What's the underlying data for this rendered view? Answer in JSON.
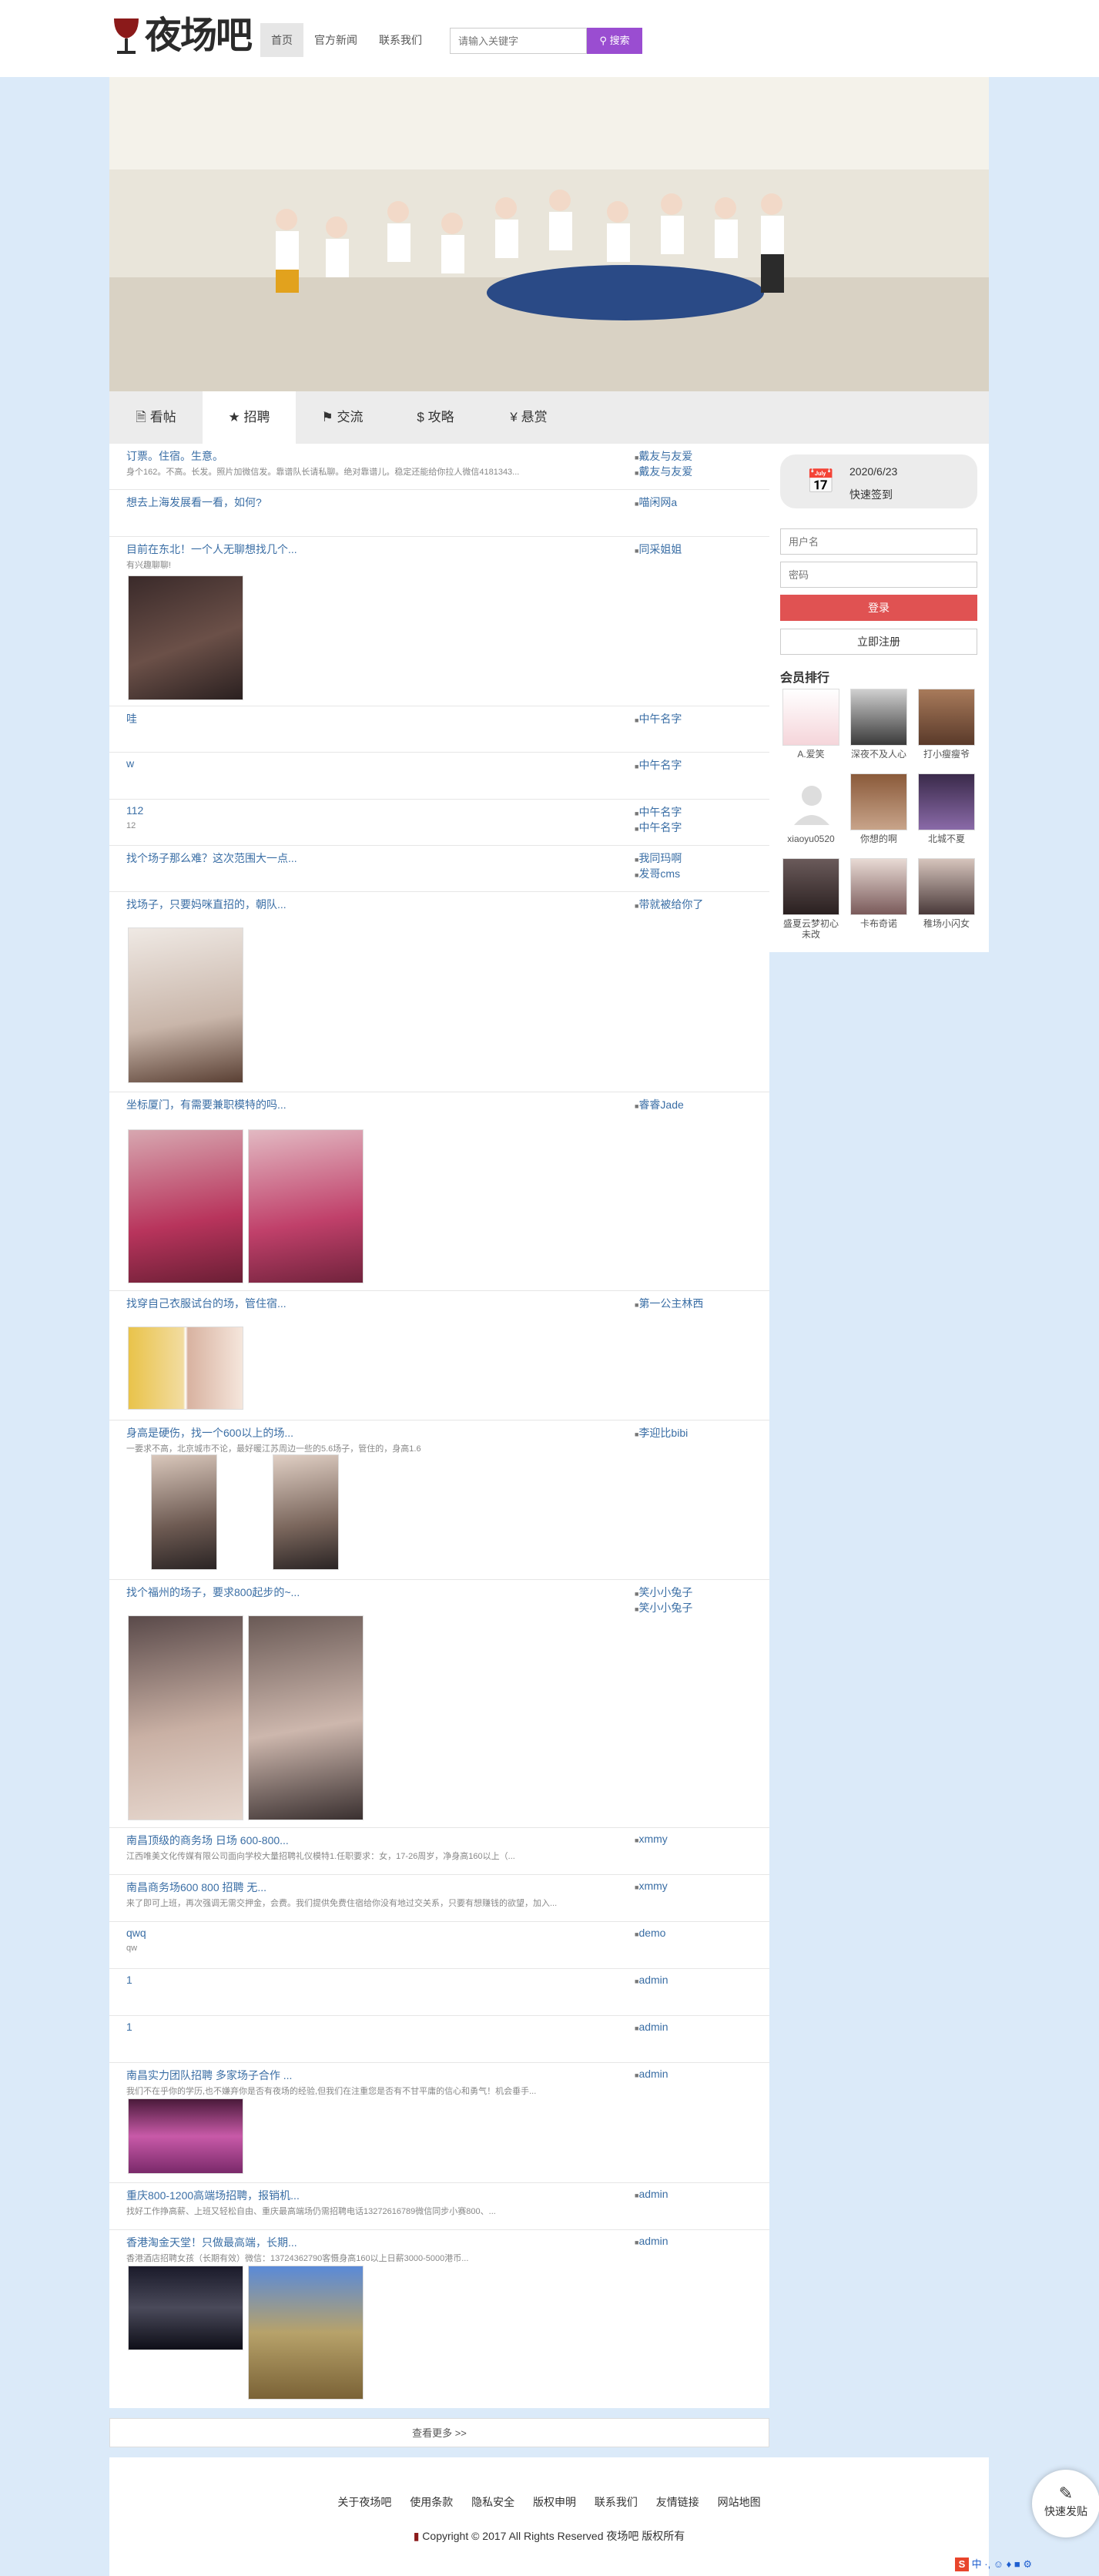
{
  "header": {
    "logo_text": "夜场吧",
    "nav": [
      "首页",
      "官方新闻",
      "联系我们"
    ],
    "search_placeholder": "请输入关键字",
    "search_btn": "搜索"
  },
  "tabs": [
    "看帖",
    "招聘",
    "交流",
    "攻略",
    "悬赏"
  ],
  "posts": [
    {
      "title": "订票。住宿。生意。",
      "summary": "身个162。不高。长发。照片加微信发。靠谱队长请私聊。绝对靠谱儿。稳定还能给你拉人微信4181343...",
      "author": "戴友与友爱",
      "reply": "戴友与友爱"
    },
    {
      "title": "想去上海发展看一看，如何?",
      "summary": "",
      "author": "喵闲网a",
      "reply": ""
    },
    {
      "title": "目前在东北！一个人无聊想找几个...",
      "summary": "有兴趣聊聊!",
      "author": "同采姐姐",
      "reply": ""
    },
    {
      "title": "哇",
      "summary": "",
      "author": "中午名字",
      "reply": ""
    },
    {
      "title": "w",
      "summary": "",
      "author": "中午名字",
      "reply": ""
    },
    {
      "title": "112",
      "summary": "12",
      "author": "中午名字",
      "reply": "中午名字"
    },
    {
      "title": "找个场子那么难？这次范围大一点...",
      "summary": "",
      "author": "我同玛啊",
      "reply": "发哥cms"
    },
    {
      "title": "找场子，只要妈咪直招的，朝队...",
      "summary": "",
      "author": "带就被给你了",
      "reply": ""
    },
    {
      "title": "坐标厦门，有需要兼职模特的吗...",
      "summary": "",
      "author": "睿睿Jade",
      "reply": ""
    },
    {
      "title": "找穿自己衣服试台的场，管住宿...",
      "summary": "",
      "author": "第一公主林西",
      "reply": ""
    },
    {
      "title": "身高是硬伤，找一个600以上的场...",
      "summary": "一要求不高，北京城市不论，最好暖江苏周边一些的5.6场子，管住的，身高1.6",
      "author": "李迎比bibi",
      "reply": ""
    },
    {
      "title": "找个福州的场子，要求800起步的~...",
      "summary": "",
      "author": "笑小小兔子",
      "reply": "笑小小兔子"
    },
    {
      "title": "南昌顶级的商务场 日场 600-800...",
      "summary": "江西唯美文化传媒有限公司面向学校大量招聘礼仪模特1.任职要求：女，17-26周岁，净身高160以上（...",
      "author": "xmmy",
      "reply": ""
    },
    {
      "title": "南昌商务场600 800 招聘 无...",
      "summary": "来了即可上班，再次强调无需交押金，会费。我们提供免费住宿给你没有地过交关系，只要有想赚钱的欲望，加入...",
      "author": "xmmy",
      "reply": ""
    },
    {
      "title": "qwq",
      "summary": "qw",
      "author": "demo",
      "reply": ""
    },
    {
      "title": "1",
      "summary": "",
      "author": "admin",
      "reply": ""
    },
    {
      "title": "1",
      "summary": "",
      "author": "admin",
      "reply": ""
    },
    {
      "title": "南昌实力团队招聘 多家场子合作 ...",
      "summary": "我们不在乎你的学历,也不嫌弃你是否有夜场的经验,但我们在注重您是否有不甘平庸的信心和勇气！机会垂手...",
      "author": "admin",
      "reply": ""
    },
    {
      "title": "重庆800-1200高端场招聘，报销机...",
      "summary": "找好工作挣高薪、上班又轻松自由、重庆最高端场仍需招聘电话13272616789微信同步小赛800、...",
      "author": "admin",
      "reply": ""
    },
    {
      "title": "香港淘金天堂！只做最高端，长期...",
      "summary": "香港酒店招聘女孩（长期有效）微信：13724362790客慑身高160以上日薪3000-5000港币...",
      "author": "admin",
      "reply": ""
    }
  ],
  "more": "查看更多 >>",
  "sidebar": {
    "date": "2020/6/23",
    "signin": "快速签到",
    "user_placeholder": "用户名",
    "pass_placeholder": "密码",
    "login": "登录",
    "register": "立即注册",
    "rank_title": "会员排行",
    "members": [
      "A.爱笑",
      "深夜不及人心",
      "打小瘦瘦爷",
      "xiaoyu0520",
      "你想的啊",
      "北城不夏",
      "盛夏云梦初心未改",
      "卡布奇诺",
      "稚场小闪女"
    ]
  },
  "footer": {
    "links": [
      "关于夜场吧",
      "使用条款",
      "隐私安全",
      "版权申明",
      "联系我们",
      "友情链接",
      "网站地图"
    ],
    "copyright": "Copyright © 2017 All Rights Reserved 夜场吧 版权所有"
  },
  "quick_post": "快速发贴",
  "tray": "中 ·, ☺ ♦ ■ ⚙",
  "colors": {
    "accent_purple": "#9a4dd1",
    "login_red": "#e05252",
    "link_blue": "#3a6ea5",
    "page_bg": "#dbeaf9"
  }
}
